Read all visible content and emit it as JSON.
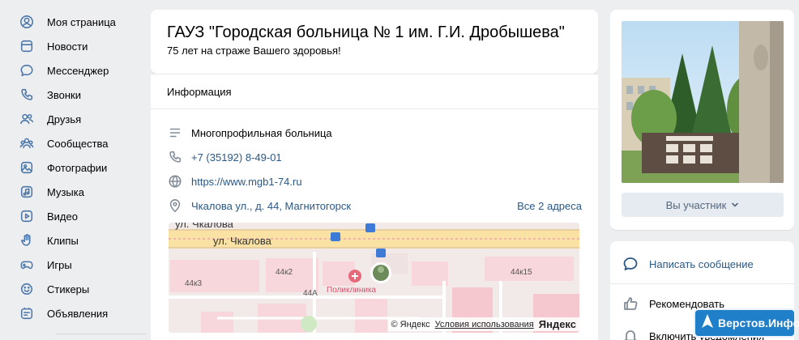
{
  "sidebar": {
    "items": [
      {
        "label": "Моя страница",
        "icon": "user-circle-icon"
      },
      {
        "label": "Новости",
        "icon": "newsfeed-icon"
      },
      {
        "label": "Мессенджер",
        "icon": "message-icon"
      },
      {
        "label": "Звонки",
        "icon": "phone-icon"
      },
      {
        "label": "Друзья",
        "icon": "friends-icon"
      },
      {
        "label": "Сообщества",
        "icon": "communities-icon"
      },
      {
        "label": "Фотографии",
        "icon": "photo-icon"
      },
      {
        "label": "Музыка",
        "icon": "music-icon"
      },
      {
        "label": "Видео",
        "icon": "video-icon"
      },
      {
        "label": "Клипы",
        "icon": "clips-icon"
      },
      {
        "label": "Игры",
        "icon": "games-icon"
      },
      {
        "label": "Стикеры",
        "icon": "sticker-icon"
      },
      {
        "label": "Объявления",
        "icon": "classifieds-icon"
      }
    ]
  },
  "group": {
    "title": "ГАУЗ \"Городская больница № 1 им. Г.И. Дробышева\"",
    "status": "75 лет на страже Вашего здоровья!"
  },
  "info": {
    "tab_label": "Информация",
    "category": "Многопрофильная больница",
    "phone": "+7 (35192) 8-49-01",
    "website": "https://www.mgb1-74.ru",
    "address": "Чкалова ул., д. 44, Магнитогорск",
    "all_addresses": "Все 2 адреса"
  },
  "map": {
    "labels": {
      "street_top": "ул. Чкалова",
      "street_main": "ул. Чкалова",
      "bld1": "44к3",
      "bld2": "44к2",
      "bld3": "44А",
      "bld4": "44к15",
      "clinic": "Поликлиника"
    },
    "copyright": "© Яндекс",
    "terms": "Условия использования",
    "brand": "Яндекс"
  },
  "right": {
    "member_button": "Вы участник",
    "actions": {
      "write": "Написать сообщение",
      "recommend": "Рекомендовать",
      "notify": "Включить уведомления"
    },
    "colors": {
      "accent": "#2a5885",
      "icon_blue": "#4a76a8",
      "button_bg": "#e5ebf1"
    }
  },
  "watermark": {
    "text": "Верстов.Инфо"
  }
}
